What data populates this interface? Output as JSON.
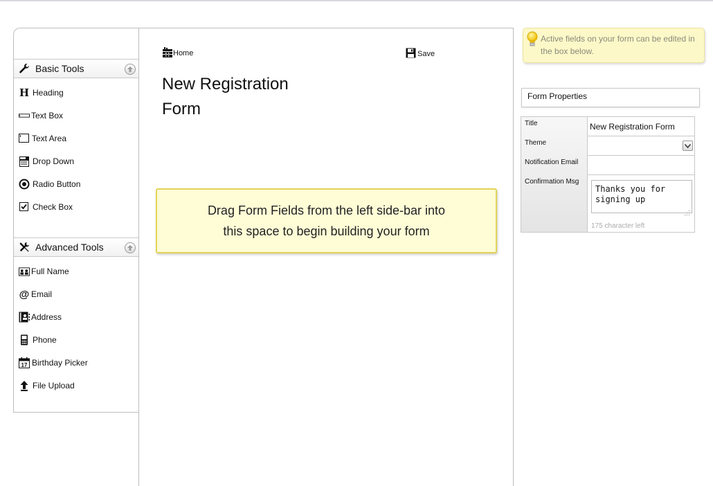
{
  "sidebar": {
    "basic": {
      "title": "Basic Tools",
      "items": [
        {
          "label": "Heading",
          "icon": "heading-icon"
        },
        {
          "label": "Text Box",
          "icon": "textbox-icon"
        },
        {
          "label": "Text Area",
          "icon": "textarea-icon"
        },
        {
          "label": "Drop Down",
          "icon": "dropdown-icon"
        },
        {
          "label": "Radio Button",
          "icon": "radio-icon"
        },
        {
          "label": "Check Box",
          "icon": "checkbox-icon"
        }
      ]
    },
    "advanced": {
      "title": "Advanced Tools",
      "items": [
        {
          "label": "Full Name",
          "icon": "fullname-icon"
        },
        {
          "label": "Email",
          "icon": "email-icon"
        },
        {
          "label": "Address",
          "icon": "address-icon"
        },
        {
          "label": "Phone",
          "icon": "phone-icon"
        },
        {
          "label": "Birthday Picker",
          "icon": "calendar-icon"
        },
        {
          "label": "File Upload",
          "icon": "upload-icon"
        }
      ]
    }
  },
  "toolbar": {
    "home_label": "Home",
    "save_label": "Save"
  },
  "form": {
    "title": "New Registration Form",
    "dropzone_text": "Drag Form Fields from the left side-bar into this space to begin building your form"
  },
  "tip": {
    "text": "Active fields on your form can be edited in the box below."
  },
  "properties": {
    "header": "Form Properties",
    "title_label": "Title",
    "title_value": "New Registration Form",
    "theme_label": "Theme",
    "theme_value": "",
    "email_label": "Notification Email",
    "email_value": "",
    "msg_label": "Confirmation Msg",
    "msg_value": "Thanks you for\nsigning up",
    "char_left": "175 character left"
  }
}
